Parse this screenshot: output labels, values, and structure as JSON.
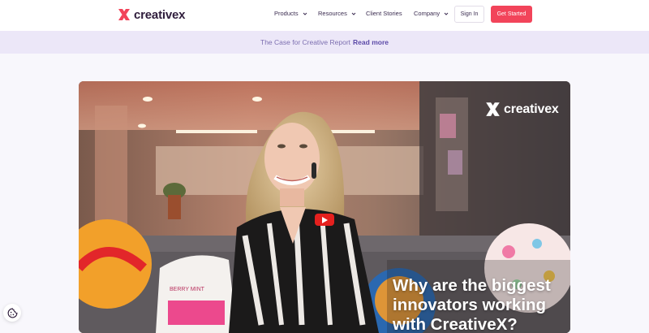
{
  "brand": {
    "name": "creativex",
    "color": "#f2445a"
  },
  "nav": {
    "items": [
      {
        "label": "Products",
        "has_dropdown": true
      },
      {
        "label": "Resources",
        "has_dropdown": true
      },
      {
        "label": "Client Stories",
        "has_dropdown": false
      },
      {
        "label": "Company",
        "has_dropdown": true
      }
    ],
    "sign_in": "Sign In",
    "get_started": "Get Started"
  },
  "banner": {
    "text": "The Case for Creative Report",
    "link": "Read more"
  },
  "video": {
    "logo_text": "creativex",
    "headline": "Why are the biggest innovators working with CreativeX?",
    "play_button": "play-icon",
    "pillow_text": "BERRY MINT"
  },
  "cookie": {
    "icon": "cookie-icon"
  }
}
